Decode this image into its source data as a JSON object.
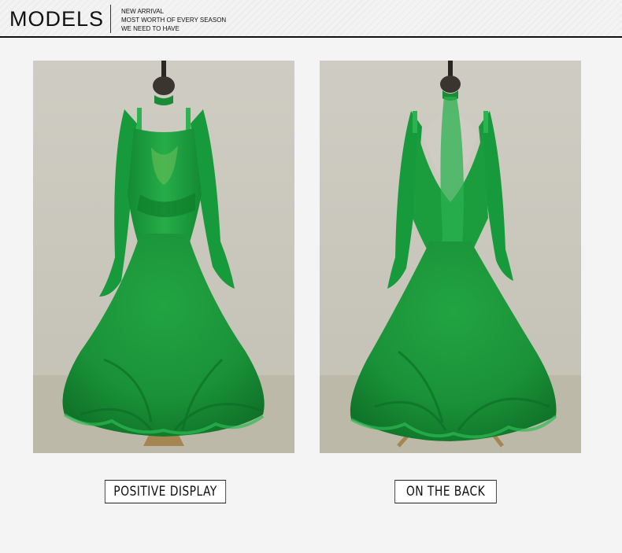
{
  "header": {
    "title": "MODELS",
    "subtitle_lines": [
      "NEW ARRIVAL",
      "MOST WORTH OF EVERY SEASON",
      "WE NEED TO HAVE"
    ]
  },
  "gallery": [
    {
      "caption": "POSITIVE DISPLAY",
      "image": "green ballroom dress front view"
    },
    {
      "caption": "ON THE BACK",
      "image": "green ballroom dress back view"
    }
  ],
  "colors": {
    "dress_green": "#1f9a3c",
    "backdrop": "#c8c6ba",
    "floor": "#bcb8a6",
    "header_bg": "#f3f3f3"
  }
}
